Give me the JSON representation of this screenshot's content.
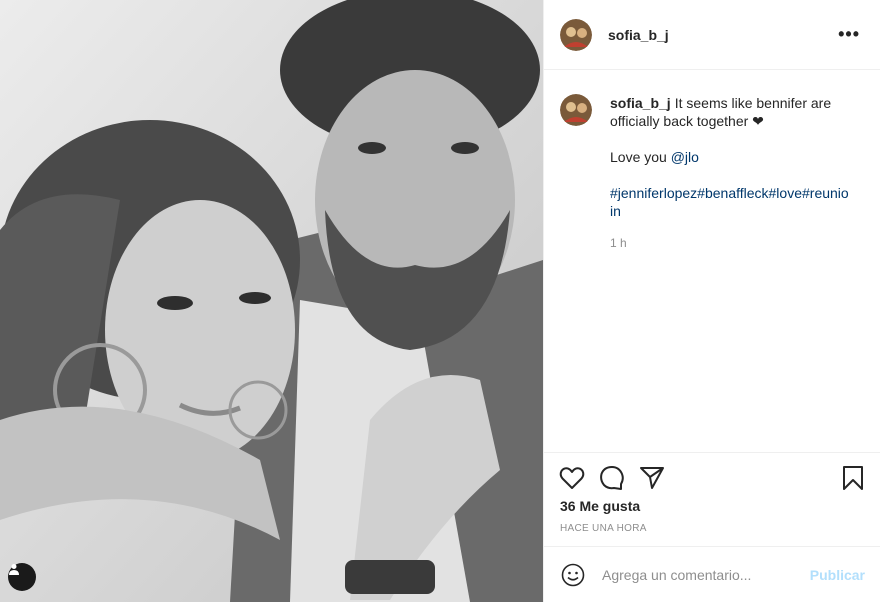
{
  "post": {
    "username": "sofia_b_j",
    "caption_user": "sofia_b_j",
    "caption_text": "It seems like bennifer are officially back together ❤",
    "love_text": "Love you",
    "mention": "@jlo",
    "hashtags": "#jenniferlopez#benaffleck#love#reunioin",
    "time_ago": "1 h"
  },
  "actions": {
    "likes": "36 Me gusta",
    "posted": "HACE UNA HORA"
  },
  "comment": {
    "placeholder": "Agrega un comentario...",
    "publish_label": "Publicar"
  },
  "icons": {
    "more": "more-options-icon",
    "like": "heart-icon",
    "comment": "comment-icon",
    "share": "share-icon",
    "save": "bookmark-icon",
    "emoji": "emoji-icon",
    "tag": "user-tag-icon"
  },
  "colors": {
    "link": "#00376b",
    "publish_disabled": "#b2dffc",
    "muted": "#8e8e8e"
  }
}
